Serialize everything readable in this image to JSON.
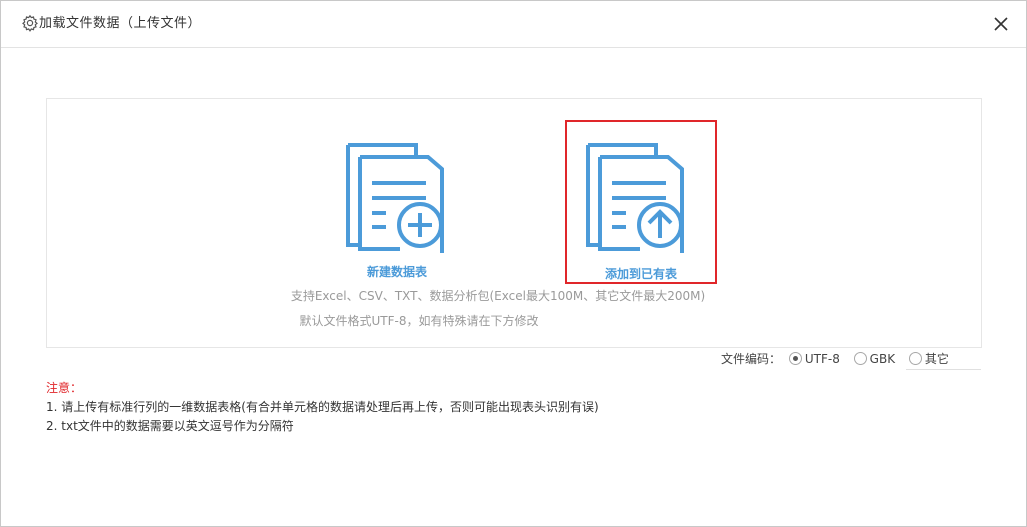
{
  "dialog": {
    "title": "加载文件数据（上传文件）"
  },
  "options": {
    "new_table": {
      "label": "新建数据表",
      "icon": "new-document-plus-icon"
    },
    "add_existing": {
      "label": "添加到已有表",
      "icon": "document-upload-icon"
    }
  },
  "support": {
    "formats": "支持Excel、CSV、TXT、数据分析包(Excel最大100M、其它文件最大200M)",
    "default_encoding": "默认文件格式UTF-8，如有特殊请在下方修改"
  },
  "encoding": {
    "label": "文件编码：",
    "options": [
      "UTF-8",
      "GBK",
      "其它"
    ],
    "selected": "UTF-8"
  },
  "notes": {
    "title": "注意：",
    "items": [
      "1. 请上传有标准行列的一维数据表格(有合并单元格的数据请处理后再上传，否则可能出现表头识别有误)",
      "2. txt文件中的数据需要以英文逗号作为分隔符"
    ]
  },
  "colors": {
    "accent": "#4c9bd9",
    "highlight": "#e0262a",
    "muted": "#9a9a9a"
  }
}
